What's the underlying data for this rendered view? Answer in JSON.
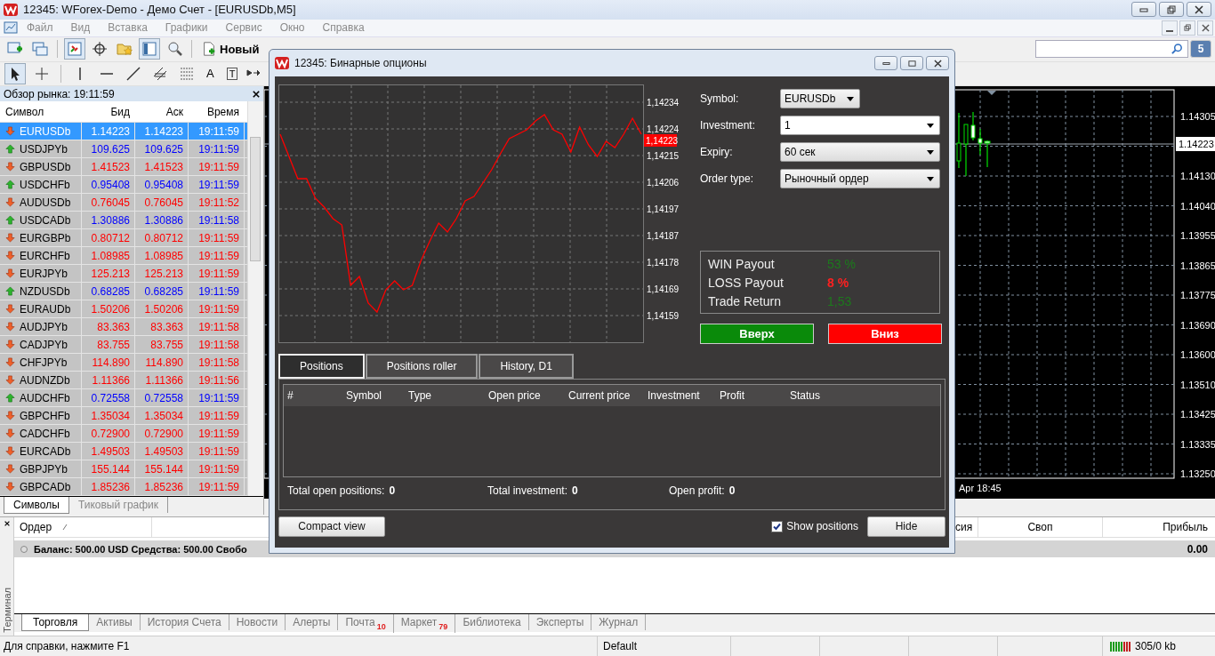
{
  "window": {
    "title": "12345: WForex-Demo - Демо Счет - [EURUSDb,M5]"
  },
  "menu": [
    "Файл",
    "Вид",
    "Вставка",
    "Графики",
    "Сервис",
    "Окно",
    "Справка"
  ],
  "toolbar": {
    "new_order_label": "Новый",
    "text_tool": "A",
    "label_tool": "T",
    "chat_count": "5"
  },
  "market_watch": {
    "title": "Обзор рынка: 19:11:59",
    "columns": [
      "Символ",
      "Бид",
      "Аск",
      "Время"
    ],
    "rows": [
      {
        "symbol": "EURUSDb",
        "bid": "1.14223",
        "ask": "1.14223",
        "time": "19:11:59",
        "rising": false,
        "selected": true
      },
      {
        "symbol": "USDJPYb",
        "bid": "109.625",
        "ask": "109.625",
        "time": "19:11:59",
        "rising": true,
        "selected": false
      },
      {
        "symbol": "GBPUSDb",
        "bid": "1.41523",
        "ask": "1.41523",
        "time": "19:11:59",
        "rising": false,
        "selected": false
      },
      {
        "symbol": "USDCHFb",
        "bid": "0.95408",
        "ask": "0.95408",
        "time": "19:11:59",
        "rising": true,
        "selected": false
      },
      {
        "symbol": "AUDUSDb",
        "bid": "0.76045",
        "ask": "0.76045",
        "time": "19:11:52",
        "rising": false,
        "selected": false
      },
      {
        "symbol": "USDCADb",
        "bid": "1.30886",
        "ask": "1.30886",
        "time": "19:11:58",
        "rising": true,
        "selected": false
      },
      {
        "symbol": "EURGBPb",
        "bid": "0.80712",
        "ask": "0.80712",
        "time": "19:11:59",
        "rising": false,
        "selected": false
      },
      {
        "symbol": "EURCHFb",
        "bid": "1.08985",
        "ask": "1.08985",
        "time": "19:11:59",
        "rising": false,
        "selected": false
      },
      {
        "symbol": "EURJPYb",
        "bid": "125.213",
        "ask": "125.213",
        "time": "19:11:59",
        "rising": false,
        "selected": false
      },
      {
        "symbol": "NZDUSDb",
        "bid": "0.68285",
        "ask": "0.68285",
        "time": "19:11:59",
        "rising": true,
        "selected": false
      },
      {
        "symbol": "EURAUDb",
        "bid": "1.50206",
        "ask": "1.50206",
        "time": "19:11:59",
        "rising": false,
        "selected": false
      },
      {
        "symbol": "AUDJPYb",
        "bid": "83.363",
        "ask": "83.363",
        "time": "19:11:58",
        "rising": false,
        "selected": false
      },
      {
        "symbol": "CADJPYb",
        "bid": "83.755",
        "ask": "83.755",
        "time": "19:11:58",
        "rising": false,
        "selected": false
      },
      {
        "symbol": "CHFJPYb",
        "bid": "114.890",
        "ask": "114.890",
        "time": "19:11:58",
        "rising": false,
        "selected": false
      },
      {
        "symbol": "AUDNZDb",
        "bid": "1.11366",
        "ask": "1.11366",
        "time": "19:11:56",
        "rising": false,
        "selected": false
      },
      {
        "symbol": "AUDCHFb",
        "bid": "0.72558",
        "ask": "0.72558",
        "time": "19:11:59",
        "rising": true,
        "selected": false
      },
      {
        "symbol": "GBPCHFb",
        "bid": "1.35034",
        "ask": "1.35034",
        "time": "19:11:59",
        "rising": false,
        "selected": false
      },
      {
        "symbol": "CADCHFb",
        "bid": "0.72900",
        "ask": "0.72900",
        "time": "19:11:59",
        "rising": false,
        "selected": false
      },
      {
        "symbol": "EURCADb",
        "bid": "1.49503",
        "ask": "1.49503",
        "time": "19:11:59",
        "rising": false,
        "selected": false
      },
      {
        "symbol": "GBPJPYb",
        "bid": "155.144",
        "ask": "155.144",
        "time": "19:11:59",
        "rising": false,
        "selected": false
      },
      {
        "symbol": "GBPCADb",
        "bid": "1.85236",
        "ask": "1.85236",
        "time": "19:11:59",
        "rising": false,
        "selected": false
      }
    ],
    "tabs": [
      {
        "label": "Символы",
        "selected": true
      },
      {
        "label": "Тиковый график",
        "selected": false
      }
    ]
  },
  "chart": {
    "price_labels": [
      "1.14305",
      "1.14130",
      "1.14040",
      "1.13955",
      "1.13865",
      "1.13775",
      "1.13690",
      "1.13600",
      "1.13510",
      "1.13425",
      "1.13335",
      "1.13250"
    ],
    "current_price": "1.14223",
    "time_label": "Apr 18:45"
  },
  "binary_options": {
    "title": "12345: Бинарные опционы",
    "chart": {
      "current_price": "1,14223",
      "axis_labels": [
        "1,14234",
        "1,14224",
        "1,14215",
        "1,14206",
        "1,14197",
        "1,14187",
        "1,14178",
        "1,14169",
        "1,14159"
      ]
    },
    "form": [
      {
        "label": "Symbol:",
        "value": "EURUSDb",
        "kind": "short"
      },
      {
        "label": "Investment:",
        "value": "1",
        "kind": "editable"
      },
      {
        "label": "Expiry:",
        "value": "60 сек",
        "kind": "dropdown"
      },
      {
        "label": "Order type:",
        "value": "Рыночный ордер",
        "kind": "dropdown"
      }
    ],
    "payout": [
      {
        "label": "WIN Payout",
        "value": "53 %",
        "positive": true
      },
      {
        "label": "LOSS Payout",
        "value": "8 %",
        "positive": false
      },
      {
        "label": "Trade Return",
        "value": "1,53",
        "positive": true
      }
    ],
    "trade_buttons": [
      {
        "label": "Вверх",
        "kind": "up"
      },
      {
        "label": "Вниз",
        "kind": "down"
      }
    ],
    "tabs": [
      {
        "label": "Positions",
        "selected": true
      },
      {
        "label": "Positions roller",
        "selected": false
      },
      {
        "label": "History, D1",
        "selected": false
      }
    ],
    "table": {
      "columns": [
        "#",
        "Symbol",
        "Type",
        "Open price",
        "Current price",
        "Investment",
        "Profit",
        "Status"
      ]
    },
    "totals": [
      {
        "label": "Total open positions:",
        "value": "0"
      },
      {
        "label": "Total investment:",
        "value": "0"
      },
      {
        "label": "Open profit:",
        "value": "0"
      }
    ],
    "compact_button": "Compact view",
    "show_positions": {
      "label": "Show positions",
      "checked": true
    },
    "hide_button": "Hide"
  },
  "terminal": {
    "side_label": "Терминал",
    "columns": [
      "Ордер",
      "сия",
      "Своп",
      "Прибыль"
    ],
    "balance": "Баланс: 500.00 USD Средства: 500.00 Свобо",
    "profit_total": "0.00",
    "tabs": [
      {
        "label": "Торговля",
        "selected": true
      },
      {
        "label": "Активы",
        "selected": false
      },
      {
        "label": "История Счета",
        "selected": false
      },
      {
        "label": "Новости",
        "selected": false
      },
      {
        "label": "Алерты",
        "selected": false
      },
      {
        "label": "Почта",
        "badge": "10",
        "selected": false
      },
      {
        "label": "Маркет",
        "badge": "79",
        "selected": false
      },
      {
        "label": "Библиотека",
        "selected": false
      },
      {
        "label": "Эксперты",
        "selected": false
      },
      {
        "label": "Журнал",
        "selected": false
      }
    ]
  },
  "status_bar": {
    "help": "Для справки, нажмите F1",
    "profile": "Default",
    "traffic": "305/0 kb"
  }
}
